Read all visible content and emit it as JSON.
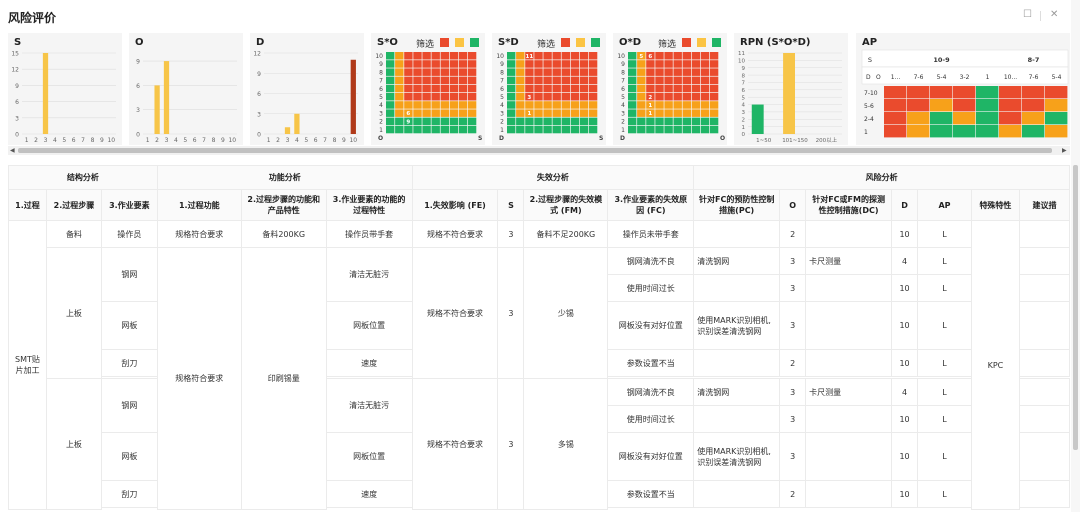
{
  "window": {
    "title": "风险评价",
    "icons": {
      "maximize": "maximize-icon",
      "close": "close-icon"
    }
  },
  "colors": {
    "bar": "#f7c548",
    "bar_dark": "#b03a1a",
    "red": "#ea4b2d",
    "orange": "#f7a11a",
    "yellow": "#fbc443",
    "green": "#1fb566",
    "grid": "#dddddd",
    "axis": "#666666"
  },
  "filter_label": "筛选",
  "charts": [
    {
      "id": "S",
      "title": "S",
      "type": "bar",
      "categories": [
        "1",
        "2",
        "3",
        "4",
        "5",
        "6",
        "7",
        "8",
        "9",
        "10"
      ],
      "values": [
        0,
        0,
        15,
        0,
        0,
        0,
        0,
        0,
        0,
        0
      ],
      "yticks": [
        0,
        3,
        6,
        9,
        12,
        15
      ],
      "ylim": [
        0,
        15
      ]
    },
    {
      "id": "O",
      "title": "O",
      "type": "bar",
      "categories": [
        "1",
        "2",
        "3",
        "4",
        "5",
        "6",
        "7",
        "8",
        "9",
        "10"
      ],
      "values": [
        0,
        6,
        9,
        0,
        0,
        0,
        0,
        0,
        0,
        0
      ],
      "yticks": [
        0,
        3,
        6,
        9
      ],
      "ylim": [
        0,
        10
      ]
    },
    {
      "id": "D",
      "title": "D",
      "type": "bar",
      "categories": [
        "1",
        "2",
        "3",
        "4",
        "5",
        "6",
        "7",
        "8",
        "9",
        "10"
      ],
      "values": [
        0,
        0,
        1,
        3,
        0,
        0,
        0,
        0,
        0,
        11
      ],
      "yticks": [
        0,
        3,
        6,
        9,
        12
      ],
      "ylim": [
        0,
        12
      ]
    },
    {
      "id": "SO",
      "title": "S*O",
      "type": "heatmap",
      "ylabels": [
        "10",
        "9",
        "8",
        "7",
        "6",
        "5",
        "4",
        "3",
        "2",
        "1"
      ],
      "xfirst": "O",
      "xlast": "S",
      "cells": [
        {
          "r": 7,
          "c": 2,
          "v": "6"
        },
        {
          "r": 8,
          "c": 2,
          "v": "9"
        }
      ]
    },
    {
      "id": "SD",
      "title": "S*D",
      "type": "heatmap",
      "ylabels": [
        "10",
        "9",
        "8",
        "7",
        "6",
        "5",
        "4",
        "3",
        "2",
        "1"
      ],
      "xfirst": "D",
      "xlast": "S",
      "cells": [
        {
          "r": 0,
          "c": 2,
          "v": "11"
        },
        {
          "r": 5,
          "c": 2,
          "v": "3"
        },
        {
          "r": 7,
          "c": 2,
          "v": "1"
        }
      ]
    },
    {
      "id": "OD",
      "title": "O*D",
      "type": "heatmap",
      "ylabels": [
        "10",
        "9",
        "8",
        "7",
        "6",
        "5",
        "4",
        "3",
        "2",
        "1"
      ],
      "xfirst": "D",
      "xlast": "O",
      "cells": [
        {
          "r": 0,
          "c": 1,
          "v": "5"
        },
        {
          "r": 0,
          "c": 2,
          "v": "6"
        },
        {
          "r": 5,
          "c": 2,
          "v": "2"
        },
        {
          "r": 6,
          "c": 2,
          "v": "1"
        },
        {
          "r": 7,
          "c": 2,
          "v": "1"
        }
      ]
    },
    {
      "id": "RPN",
      "title": "RPN (S*O*D)",
      "type": "bar",
      "categories": [
        "1~50",
        "101~150",
        "200以上"
      ],
      "values": [
        4,
        11
      ],
      "yticks": [
        "0",
        "1",
        "2",
        "3",
        "4",
        "5",
        "6",
        "7",
        "8",
        "9",
        "10",
        "11"
      ],
      "ylim": [
        0,
        11
      ]
    }
  ],
  "ap": {
    "title": "AP",
    "s_label": "S",
    "d_label": "D",
    "o_label": "O",
    "groups": [
      "10-9",
      "8-7"
    ],
    "subcols": [
      "1...",
      "7-6",
      "5-4",
      "3-2",
      "1",
      "10...",
      "7-6",
      "5-4"
    ],
    "rows": [
      "7-10",
      "5-6",
      "2-4",
      "1"
    ]
  },
  "table": {
    "groups": [
      "结构分析",
      "功能分析",
      "失效分析",
      "风险分析"
    ],
    "headers": [
      "1.过程",
      "2.过程步骤",
      "3.作业要素",
      "1.过程功能",
      "2.过程步骤的功能和产品特性",
      "3.作业要素的功能的过程特性",
      "1.失效影响 (FE)",
      "S",
      "2.过程步骤的失效模式 (FM)",
      "3.作业要素的失效原因 (FC)",
      "针对FC的预防性控制措施(PC)",
      "O",
      "针对FC或FM的探测性控制措施(DC)",
      "D",
      "AP",
      "特殊特性",
      "建议措"
    ],
    "process": "SMT贴片加工",
    "process_function": "规格符合要求",
    "product_char": "印刷锡量",
    "special": "KPC",
    "row1": {
      "step": "备料",
      "element": "操作员",
      "func": "规格符合要求",
      "char": "备料200KG",
      "echar": "操作员带手套",
      "fe": "规格不符合要求",
      "s": "3",
      "fm": "备料不足200KG",
      "fc": "操作员未带手套",
      "o": "2",
      "d": "10",
      "ap": "L"
    },
    "blocks": [
      {
        "step": "上板",
        "fe": "规格不符合要求",
        "s": "3",
        "fm": "少锡"
      },
      {
        "step": "上板",
        "fe": "规格不符合要求",
        "s": "3",
        "fm": "多锡"
      }
    ],
    "elements": [
      "钢网",
      "网板",
      "刮刀"
    ],
    "echars": [
      "清洁无脏污",
      "网板位置",
      "速度"
    ],
    "subrows": [
      {
        "fc": "钢网清洗不良",
        "pc": "清洗钢网",
        "o": "3",
        "dc": "卡尺测量",
        "d": "4",
        "ap": "L"
      },
      {
        "fc": "使用时间过长",
        "pc": "",
        "o": "3",
        "dc": "",
        "d": "10",
        "ap": "L"
      },
      {
        "fc": "网板没有对好位置",
        "pc": "使用MARK识别相机,识别误差清洗钢网",
        "o": "3",
        "dc": "",
        "d": "10",
        "ap": "L"
      },
      {
        "fc": "参数设置不当",
        "pc": "",
        "o": "2",
        "dc": "",
        "d": "10",
        "ap": "L"
      }
    ]
  }
}
